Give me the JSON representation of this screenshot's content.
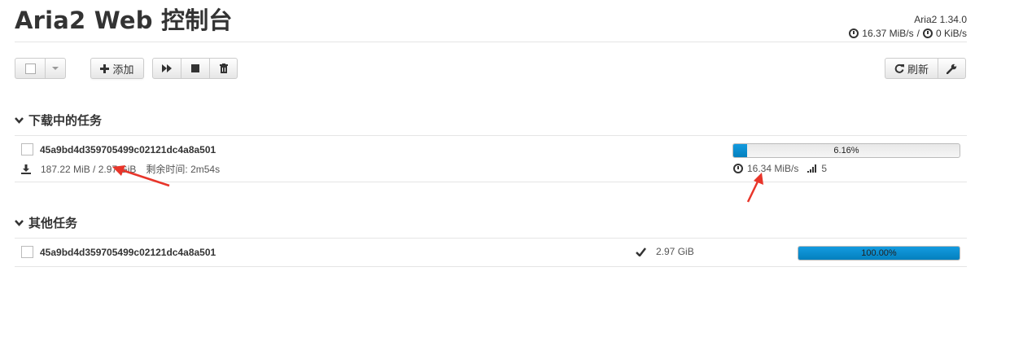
{
  "app": {
    "title": "Aria2 Web 控制台",
    "version": "Aria2 1.34.0",
    "download_speed": "16.37 MiB/s",
    "separator": "/",
    "upload_speed": "0 KiB/s"
  },
  "toolbar": {
    "add_label": "添加",
    "refresh_label": "刷新"
  },
  "sections": {
    "active": "下载中的任务",
    "others": "其他任务"
  },
  "active_task": {
    "name": "45a9bd4d359705499c02121dc4a8a501",
    "size": "187.22 MiB / 2.97 GiB",
    "remaining": "剩余时间: 2m54s",
    "progress_label": "6.16%",
    "progress": 0.0616,
    "speed": "16.34 MiB/s",
    "connections": "5"
  },
  "other_task": {
    "name": "45a9bd4d359705499c02121dc4a8a501",
    "size": "2.97 GiB",
    "progress_label": "100.00%",
    "progress": 1.0
  },
  "colors": {
    "accent": "#149bdf",
    "annotation": "#e8352a"
  },
  "icons": [
    "clock-icon",
    "plus-icon",
    "play-icon",
    "stop-icon",
    "trash-icon",
    "refresh-icon",
    "wrench-icon",
    "download-icon",
    "signal-icon",
    "check-icon",
    "chevron-down-icon"
  ]
}
